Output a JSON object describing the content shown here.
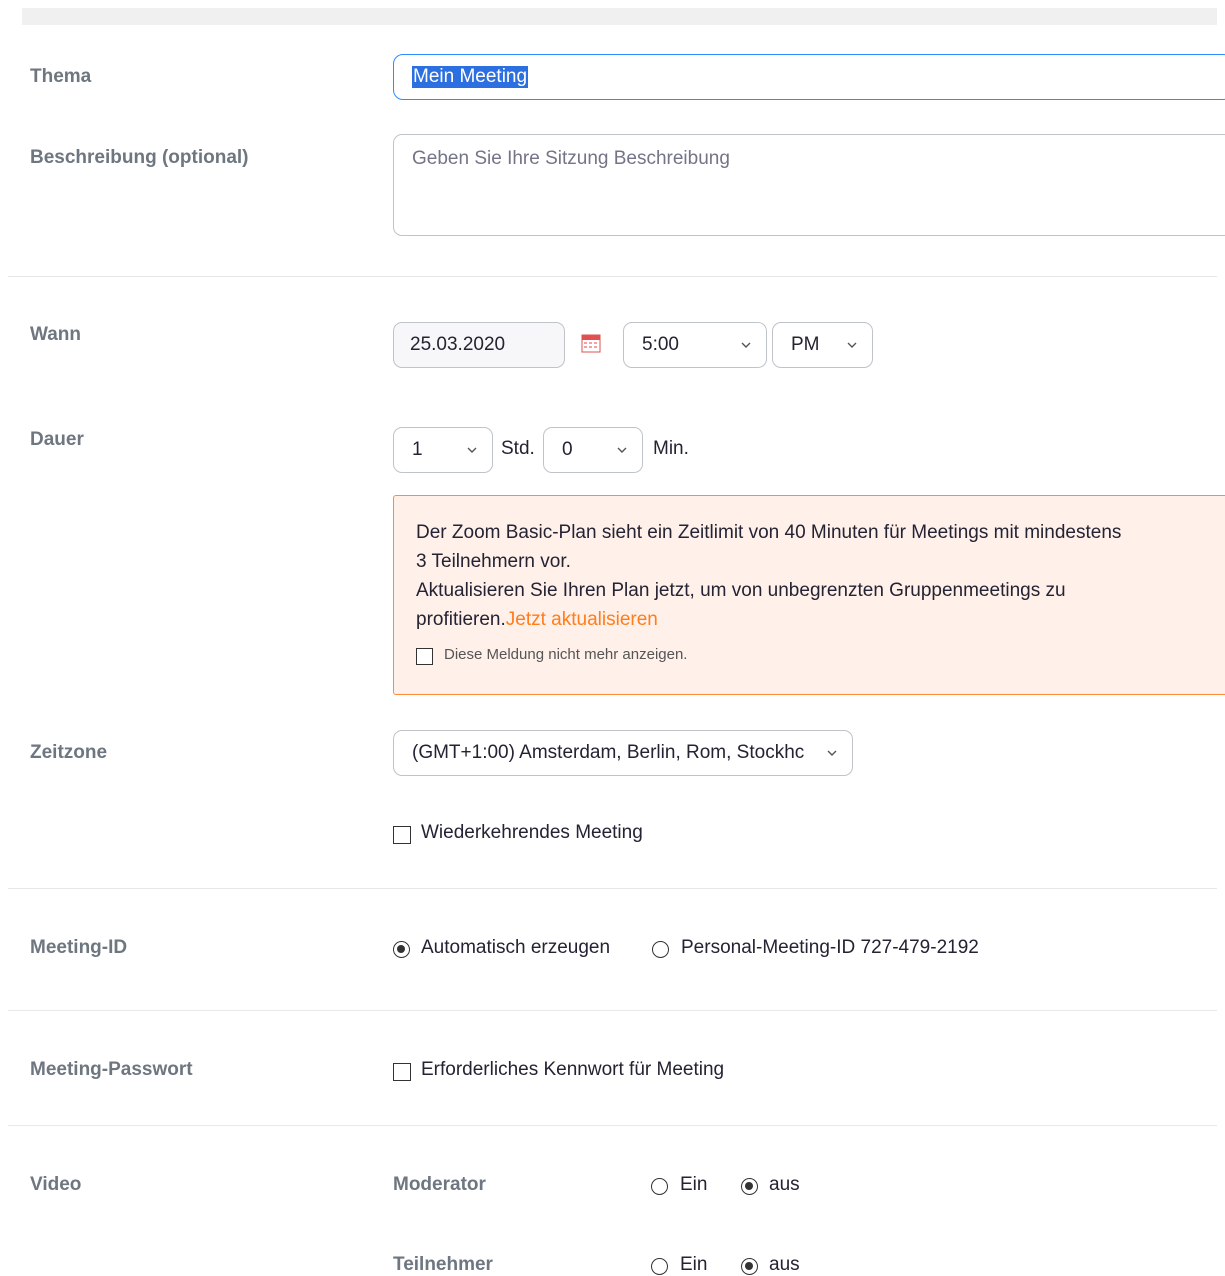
{
  "labels": {
    "topic": "Thema",
    "description": "Beschreibung (optional)",
    "when": "Wann",
    "duration": "Dauer",
    "timezone": "Zeitzone",
    "meeting_id": "Meeting-ID",
    "meeting_password": "Meeting-Passwort",
    "video": "Video"
  },
  "topic": {
    "value": "Mein Meeting"
  },
  "description": {
    "placeholder": "Geben Sie Ihre Sitzung Beschreibung"
  },
  "when": {
    "date": "25.03.2020",
    "time": "5:00",
    "ampm": "PM"
  },
  "duration": {
    "hours": "1",
    "hours_unit": "Std.",
    "minutes": "0",
    "minutes_unit": "Min."
  },
  "notice": {
    "line1": "Der Zoom Basic-Plan sieht ein Zeitlimit von 40 Minuten für Meetings mit mindestens",
    "line2": "3 Teilnehmern vor.",
    "line3": "Aktualisieren Sie Ihren Plan jetzt, um von unbegrenzten Gruppenmeetings zu",
    "line4": "profitieren.",
    "link": "Jetzt aktualisieren",
    "dont_show": "Diese Meldung nicht mehr anzeigen."
  },
  "timezone": {
    "value": "(GMT+1:00) Amsterdam, Berlin, Rom, Stockhc"
  },
  "recurring": {
    "label": "Wiederkehrendes Meeting",
    "checked": false
  },
  "meeting_id": {
    "auto": "Automatisch erzeugen",
    "personal": "Personal-Meeting-ID 727-479-2192",
    "selected": "auto"
  },
  "password": {
    "label": "Erforderliches Kennwort für Meeting",
    "checked": false
  },
  "video": {
    "host": {
      "label": "Moderator",
      "on": "Ein",
      "off": "aus",
      "selected": "off"
    },
    "participants": {
      "label": "Teilnehmer",
      "on": "Ein",
      "off": "aus",
      "selected": "off"
    }
  },
  "colors": {
    "accent": "#2d8cff",
    "warning_bg": "#fff0ea",
    "warning_border": "#ff8c3c",
    "link": "#ff7d1a"
  }
}
